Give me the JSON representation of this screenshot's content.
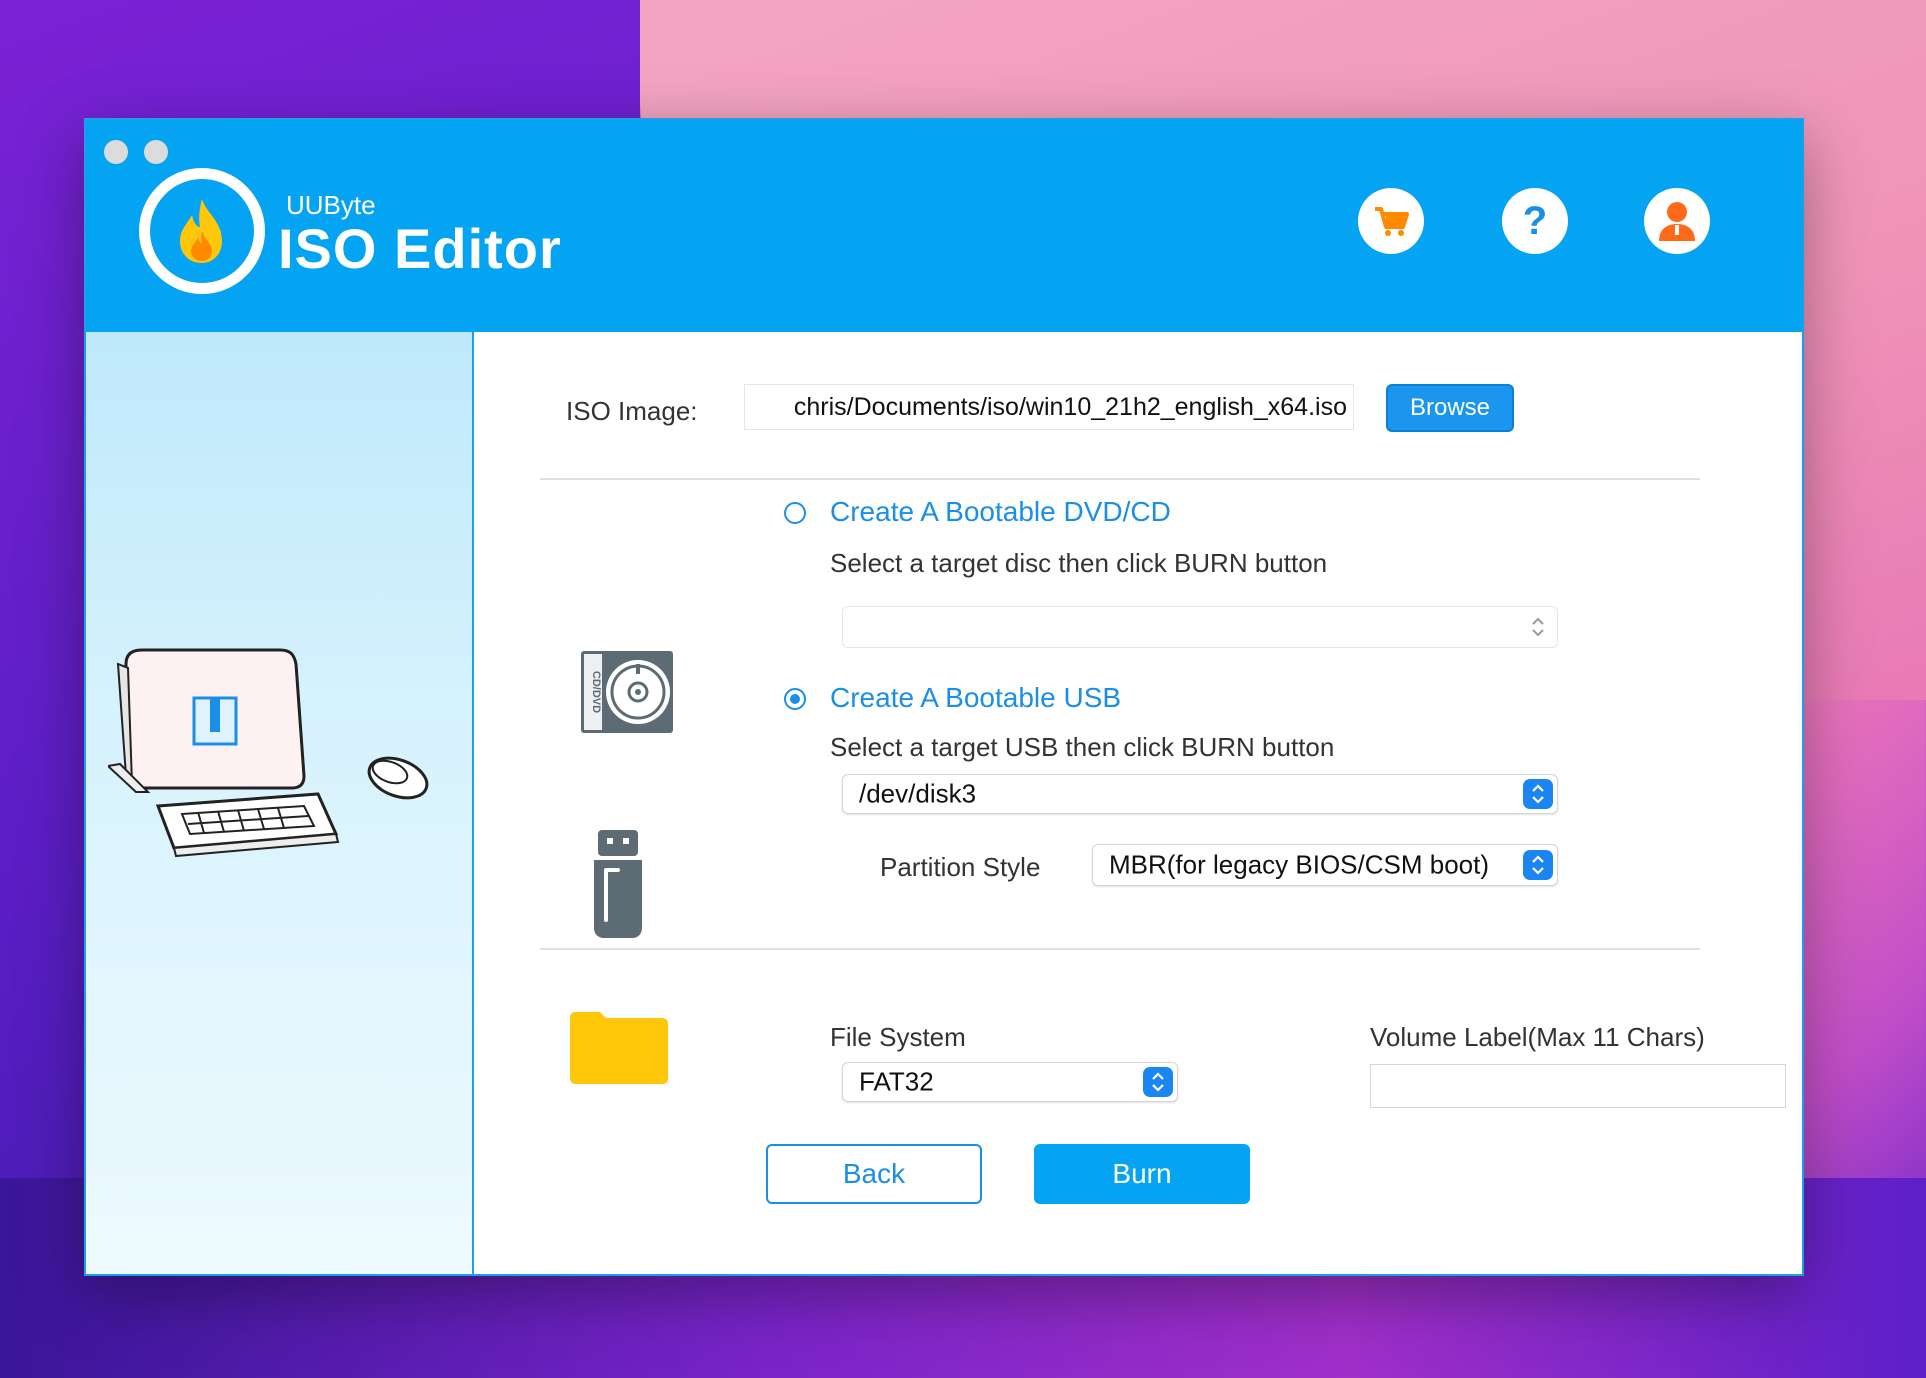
{
  "window": {
    "brand_small": "UUByte",
    "brand_big": "ISO Editor"
  },
  "header_icons": [
    "cart-icon",
    "help-icon",
    "user-icon"
  ],
  "iso": {
    "label": "ISO Image:",
    "path": "chris/Documents/iso/win10_21h2_english_x64.iso",
    "browse_label": "Browse"
  },
  "dvd": {
    "title": "Create A Bootable DVD/CD",
    "hint": "Select a target disc then click BURN button",
    "selected": "",
    "disc_label": "CD/DVD"
  },
  "usb": {
    "title": "Create A Bootable USB",
    "hint": "Select a target USB then click BURN button",
    "selected": "/dev/disk3",
    "partition_label": "Partition Style",
    "partition_value": "MBR(for legacy BIOS/CSM boot)"
  },
  "fs": {
    "label": "File System",
    "value": "FAT32",
    "volume_label": "Volume Label(Max 11 Chars)",
    "volume_value": ""
  },
  "actions": {
    "back": "Back",
    "burn": "Burn"
  },
  "colors": {
    "header": "#04a4f2",
    "accent": "#1b8fe6",
    "folder": "#ffc60a"
  }
}
